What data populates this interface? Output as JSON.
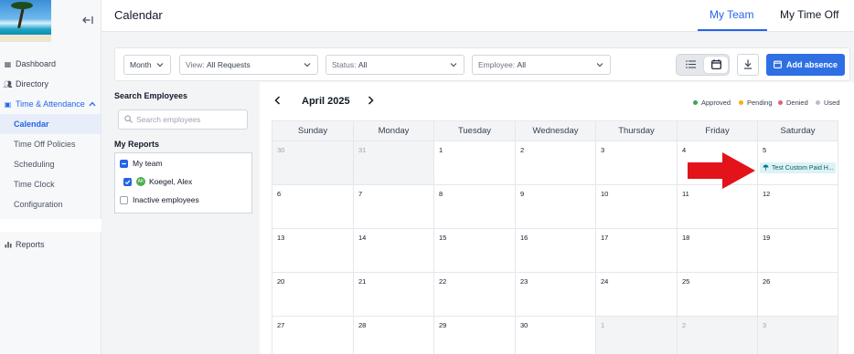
{
  "sidebar": {
    "items": [
      {
        "label": "Dashboard"
      },
      {
        "label": "Directory"
      },
      {
        "label": "Time & Attendance"
      },
      {
        "label": "Reports"
      }
    ],
    "sub_items": [
      {
        "label": "Calendar"
      },
      {
        "label": "Time Off Policies"
      },
      {
        "label": "Scheduling"
      },
      {
        "label": "Time Clock"
      },
      {
        "label": "Configuration"
      }
    ]
  },
  "header": {
    "title": "Calendar",
    "tabs": [
      {
        "label": "My Team"
      },
      {
        "label": "My Time Off"
      }
    ]
  },
  "filters": {
    "period": "Month",
    "view_label": "View:",
    "view_value": "All Requests",
    "status_label": "Status:",
    "status_value": "All",
    "employee_label": "Employee:",
    "employee_value": "All",
    "add_label": "Add absence"
  },
  "employees_panel": {
    "title": "Search Employees",
    "search_placeholder": "Search employees",
    "reports_title": "My Reports",
    "rows": [
      {
        "label": "My team"
      },
      {
        "label": "Koegel, Alex",
        "initials": "AK"
      },
      {
        "label": "Inactive employees"
      }
    ]
  },
  "calendar": {
    "month": "April 2025",
    "legend": [
      {
        "label": "Approved",
        "color": "#34a853"
      },
      {
        "label": "Pending",
        "color": "#f4b400"
      },
      {
        "label": "Denied",
        "color": "#e0607e"
      },
      {
        "label": "Used",
        "color": "#b8bec8"
      }
    ],
    "days_of_week": [
      "Sunday",
      "Monday",
      "Tuesday",
      "Wednesday",
      "Thursday",
      "Friday",
      "Saturday"
    ],
    "weeks": [
      [
        "30",
        "31",
        "1",
        "2",
        "3",
        "4",
        "5"
      ],
      [
        "6",
        "7",
        "8",
        "9",
        "10",
        "11",
        "12"
      ],
      [
        "13",
        "14",
        "15",
        "16",
        "17",
        "18",
        "19"
      ],
      [
        "20",
        "21",
        "22",
        "23",
        "24",
        "25",
        "26"
      ],
      [
        "27",
        "28",
        "29",
        "30",
        "1",
        "2",
        "3"
      ]
    ],
    "event": {
      "label": "Test Custom Paid H...",
      "icon": "beach-umbrella-icon"
    }
  },
  "colors": {
    "accent": "#2563eb",
    "arrow": "#e3131b"
  }
}
